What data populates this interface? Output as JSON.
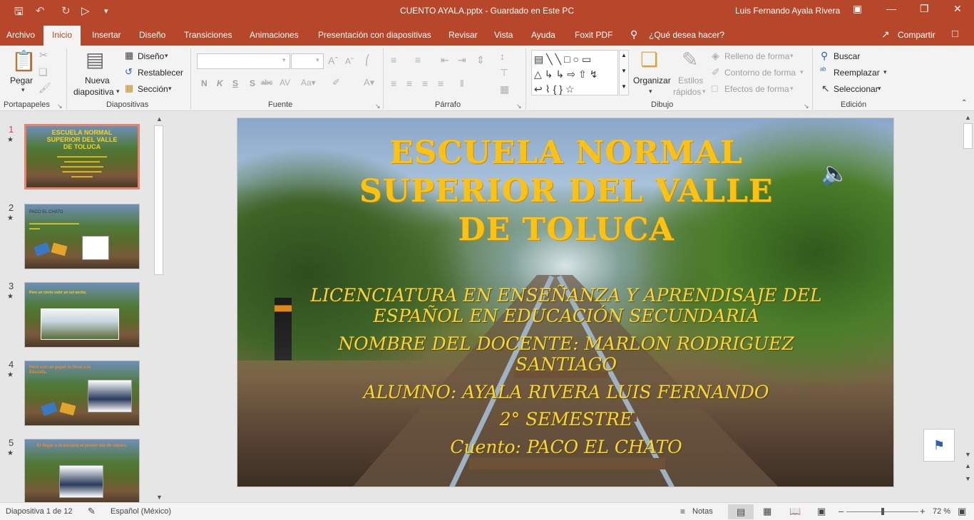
{
  "window": {
    "title": "CUENTO AYALA.pptx  -  Guardado en Este PC",
    "user": "Luis Fernando Ayala Rivera"
  },
  "quick_access": {
    "save_icon": "save-icon",
    "undo_icon": "undo-icon",
    "redo_icon": "redo-icon",
    "present_icon": "present-icon",
    "customize_icon": "customize-icon"
  },
  "tabs": [
    "Archivo",
    "Inicio",
    "Insertar",
    "Diseño",
    "Transiciones",
    "Animaciones",
    "Presentación con diapositivas",
    "Revisar",
    "Vista",
    "Ayuda",
    "Foxit PDF"
  ],
  "tell_me": "¿Qué desea hacer?",
  "share": "Compartir",
  "ribbon": {
    "clipboard": {
      "paste": "Pegar",
      "group": "Portapapeles"
    },
    "slides": {
      "new_slide_1": "Nueva",
      "new_slide_2": "diapositiva",
      "layout": "Diseño",
      "reset": "Restablecer",
      "section": "Sección",
      "group": "Diapositivas"
    },
    "font": {
      "bold": "N",
      "italic": "K",
      "underline": "S",
      "shadow": "S",
      "strike": "abc",
      "group": "Fuente"
    },
    "paragraph": {
      "group": "Párrafo"
    },
    "drawing": {
      "arrange": "Organizar",
      "quick_styles_1": "Estilos",
      "quick_styles_2": "rápidos",
      "fill": "Relleno de forma",
      "outline": "Contorno de forma",
      "effects": "Efectos de forma",
      "group": "Dibujo"
    },
    "editing": {
      "find": "Buscar",
      "replace": "Reemplazar",
      "select": "Seleccionar",
      "group": "Edición"
    }
  },
  "thumbnails": [
    {
      "num": "1",
      "lines": [
        "ESCUELA NORMAL",
        "SUPERIOR DEL VALLE",
        "DE TOLUCA"
      ]
    },
    {
      "num": "2",
      "lines": [
        "PACO EL CHATO"
      ]
    },
    {
      "num": "3",
      "lines": [
        "Pero un cierto valor un sol ancho."
      ]
    },
    {
      "num": "4",
      "lines": [
        "Pero con un papel lo llevo a la Escuela."
      ]
    },
    {
      "num": "5",
      "lines": [
        "El llegar a la escuela el primer día de clases."
      ]
    }
  ],
  "slide": {
    "title": [
      "ESCUELA NORMAL",
      "SUPERIOR DEL VALLE",
      "DE TOLUCA"
    ],
    "body": [
      "LICENCIATURA EN ENSEÑANZA Y APRENDISAJE DEL",
      "ESPAÑOL EN EDUCACIÓN SECUNDARIA",
      "NOMBRE DEL DOCENTE: MARLON RODRIGUEZ",
      "SANTIAGO",
      "ALUMNO: AYALA RIVERA LUIS FERNANDO",
      "2° SEMESTRE",
      "Cuento: PACO EL CHATO"
    ]
  },
  "status": {
    "slide_count": "Diapositiva 1 de 12",
    "language": "Español (México)",
    "notes": "Notas",
    "zoom": "72 %",
    "zoom_level": 0.5
  },
  "colors": {
    "accent": "#b7472a",
    "title_yellow": "#ffc20e",
    "body_yellow": "#f5d63a",
    "selected_thumb": "#e8836b"
  }
}
